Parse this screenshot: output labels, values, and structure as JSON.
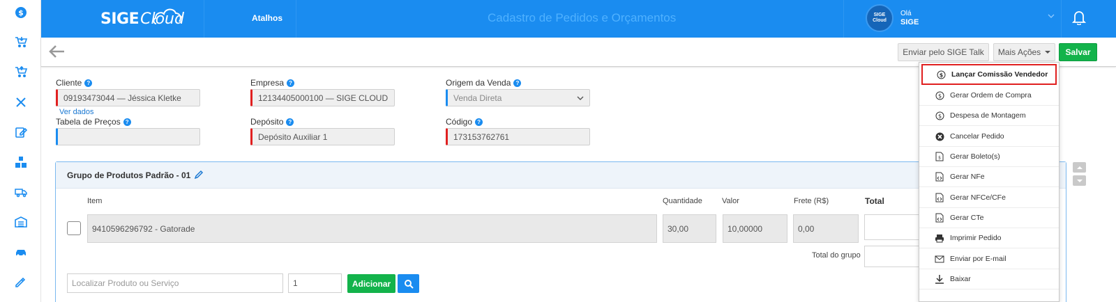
{
  "header": {
    "logo_sige": "SIGE",
    "logo_cloud": "Cloud",
    "atalhos": "Atalhos",
    "title": "Cadastro de Pedidos e Orçamentos",
    "avatar_text_1": "SIGE",
    "avatar_text_2": "Cloud",
    "greeting": "Olá",
    "user": "SIGE"
  },
  "toolbar": {
    "send_talk": "Enviar pelo SIGE Talk",
    "more_actions": "Mais Ações",
    "save": "Salvar"
  },
  "form": {
    "cliente": {
      "label": "Cliente",
      "value": "09193473044 — Jéssica Kletke"
    },
    "ver_dados": "Ver dados",
    "empresa": {
      "label": "Empresa",
      "value": "12134405000100 — SIGE CLOUD"
    },
    "origem": {
      "label": "Origem da Venda",
      "value": "Venda Direta"
    },
    "tabela": {
      "label": "Tabela de Preços",
      "value": ""
    },
    "deposito": {
      "label": "Depósito",
      "value": "Depósito Auxiliar 1"
    },
    "codigo": {
      "label": "Código",
      "value": "173153762761"
    }
  },
  "group": {
    "title": "Grupo de Produtos Padrão - 01",
    "columns": {
      "item": "Item",
      "quantidade": "Quantidade",
      "valor": "Valor",
      "frete": "Frete (R$)",
      "total": "Total"
    },
    "row": {
      "item": "9410596296792 - Gatorade",
      "quantidade": "30,00",
      "valor": "10,00000",
      "frete": "0,00",
      "total": ""
    },
    "total_grupo_label": "Total do grupo",
    "search_placeholder": "Localizar Produto ou Serviço",
    "qty_default": "1",
    "add_button": "Adicionar"
  },
  "menu": {
    "items": [
      {
        "label": "Lançar Comissão Vendedor",
        "icon": "dollar-circle-icon"
      },
      {
        "label": "Gerar Ordem de Compra",
        "icon": "dollar-circle-icon"
      },
      {
        "label": "Despesa de Montagem",
        "icon": "dollar-circle-icon"
      },
      {
        "label": "Cancelar Pedido",
        "icon": "cancel-circle-icon"
      },
      {
        "label": "Gerar Boleto(s)",
        "icon": "boleto-file-icon"
      },
      {
        "label": "Gerar NFe",
        "icon": "code-file-icon"
      },
      {
        "label": "Gerar NFCe/CFe",
        "icon": "code-file-icon"
      },
      {
        "label": "Gerar CTe",
        "icon": "code-file-icon"
      },
      {
        "label": "Imprimir Pedido",
        "icon": "printer-icon"
      },
      {
        "label": "Enviar por E-mail",
        "icon": "envelope-icon"
      },
      {
        "label": "Baixar",
        "icon": "download-icon"
      }
    ]
  },
  "colors": {
    "primary": "#1a8cf0",
    "success": "#13b34b",
    "required": "#e02020"
  }
}
